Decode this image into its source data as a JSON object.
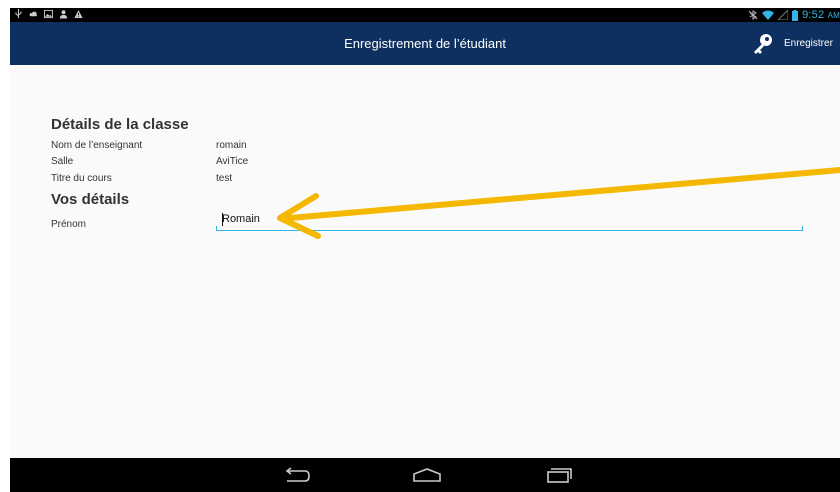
{
  "status_bar": {
    "time": "9:52",
    "ampm": "AM",
    "left_icons": [
      "usb-icon",
      "cloud-icon",
      "image-icon",
      "person-icon",
      "warning-icon"
    ],
    "right_icons": [
      "bluetooth-off-icon",
      "wifi-icon",
      "signal-icon",
      "battery-icon"
    ]
  },
  "action_bar": {
    "title": "Enregistrement de l’étudiant",
    "action_label": "Enregistrer",
    "action_icon": "key-icon",
    "background": "#0e3060"
  },
  "class_details": {
    "heading": "Détails de la classe",
    "rows": [
      {
        "label": "Nom de l’enseignant",
        "value": "romain"
      },
      {
        "label": "Salle",
        "value": "AviTice"
      },
      {
        "label": "Titre du cours",
        "value": "test"
      }
    ]
  },
  "your_details": {
    "heading": "Vos détails",
    "first_name_label": "Prénom",
    "first_name_value": "Romain"
  },
  "nav_bar": {
    "buttons": [
      "back-icon",
      "home-icon",
      "recent-apps-icon"
    ]
  },
  "colors": {
    "accent": "#33b5e5",
    "annotation_arrow": "#f5b800"
  }
}
